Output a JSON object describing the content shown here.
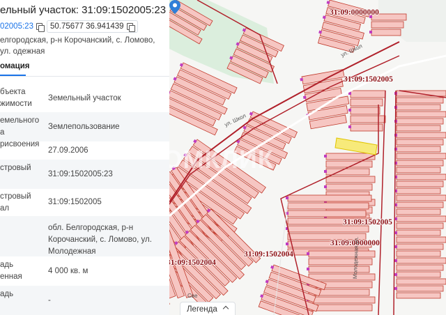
{
  "panel": {
    "title": "ельный участок: 31:09:1502005:23",
    "cadastral_chip": "02005:23",
    "coords_chip": "50.75677 36.941439",
    "address_line": "елгородская, р-н Корочанский, с. Ломово, ул. одежная",
    "tab": "омация",
    "rows": [
      {
        "label": "бъекта\nжимости",
        "value": "Земельный участок"
      },
      {
        "label": "емельного\nа",
        "value": "Землепользование"
      },
      {
        "label": "рисвоения",
        "value": "27.09.2006"
      },
      {
        "label": "стровый",
        "value": "31:09:1502005:23"
      },
      {
        "label": "стровый\nал",
        "value": "31:09:1502005"
      },
      {
        "label": "",
        "value": "обл. Белгородская, р-н Корочанский, с. Ломово, ул. Молодежная"
      },
      {
        "label": "адь\nенная",
        "value": "4 000 кв. м"
      },
      {
        "label": "адь",
        "value": "-"
      }
    ]
  },
  "map": {
    "cadastral_labels": [
      "31:09:0000000",
      "31:09:1502005",
      "31:09:1502005",
      "31:09:0000000",
      "31:09:1502004",
      "31:09:1502004"
    ],
    "street_labels": [
      "ул. Школ",
      "ул. Школ",
      "Молодежная ул.",
      "Све"
    ],
    "legend_label": "Легенда",
    "watermark": "ДОМКЛИК",
    "colors": {
      "parcel_fill": "#f6c6c2",
      "parcel_stroke": "#c0392b",
      "quarter_border": "#b0202a",
      "selected_parcel": "#f7ea7a",
      "marker": "#c03cc0",
      "pin": "#2f7fd8",
      "green_area": "#dbeedd"
    }
  }
}
